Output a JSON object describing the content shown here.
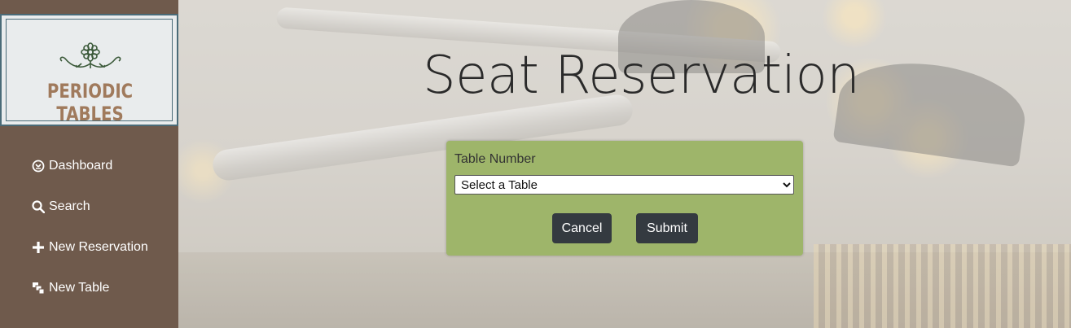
{
  "brand": {
    "logo_text": "PERIODIC TABLES"
  },
  "sidebar": {
    "items": [
      {
        "label": "Dashboard",
        "icon": "dashboard-icon"
      },
      {
        "label": "Search",
        "icon": "search-icon"
      },
      {
        "label": "New Reservation",
        "icon": "plus-icon"
      },
      {
        "label": "New Table",
        "icon": "layers-icon"
      }
    ]
  },
  "page": {
    "title": "Seat Reservation"
  },
  "form": {
    "table_label": "Table Number",
    "table_select_value": "Select a Table",
    "cancel_label": "Cancel",
    "submit_label": "Submit"
  },
  "colors": {
    "sidebar": "#6f5a4c",
    "card": "#9eb56a",
    "button": "#343a40",
    "logo_text": "#a07a5c"
  }
}
